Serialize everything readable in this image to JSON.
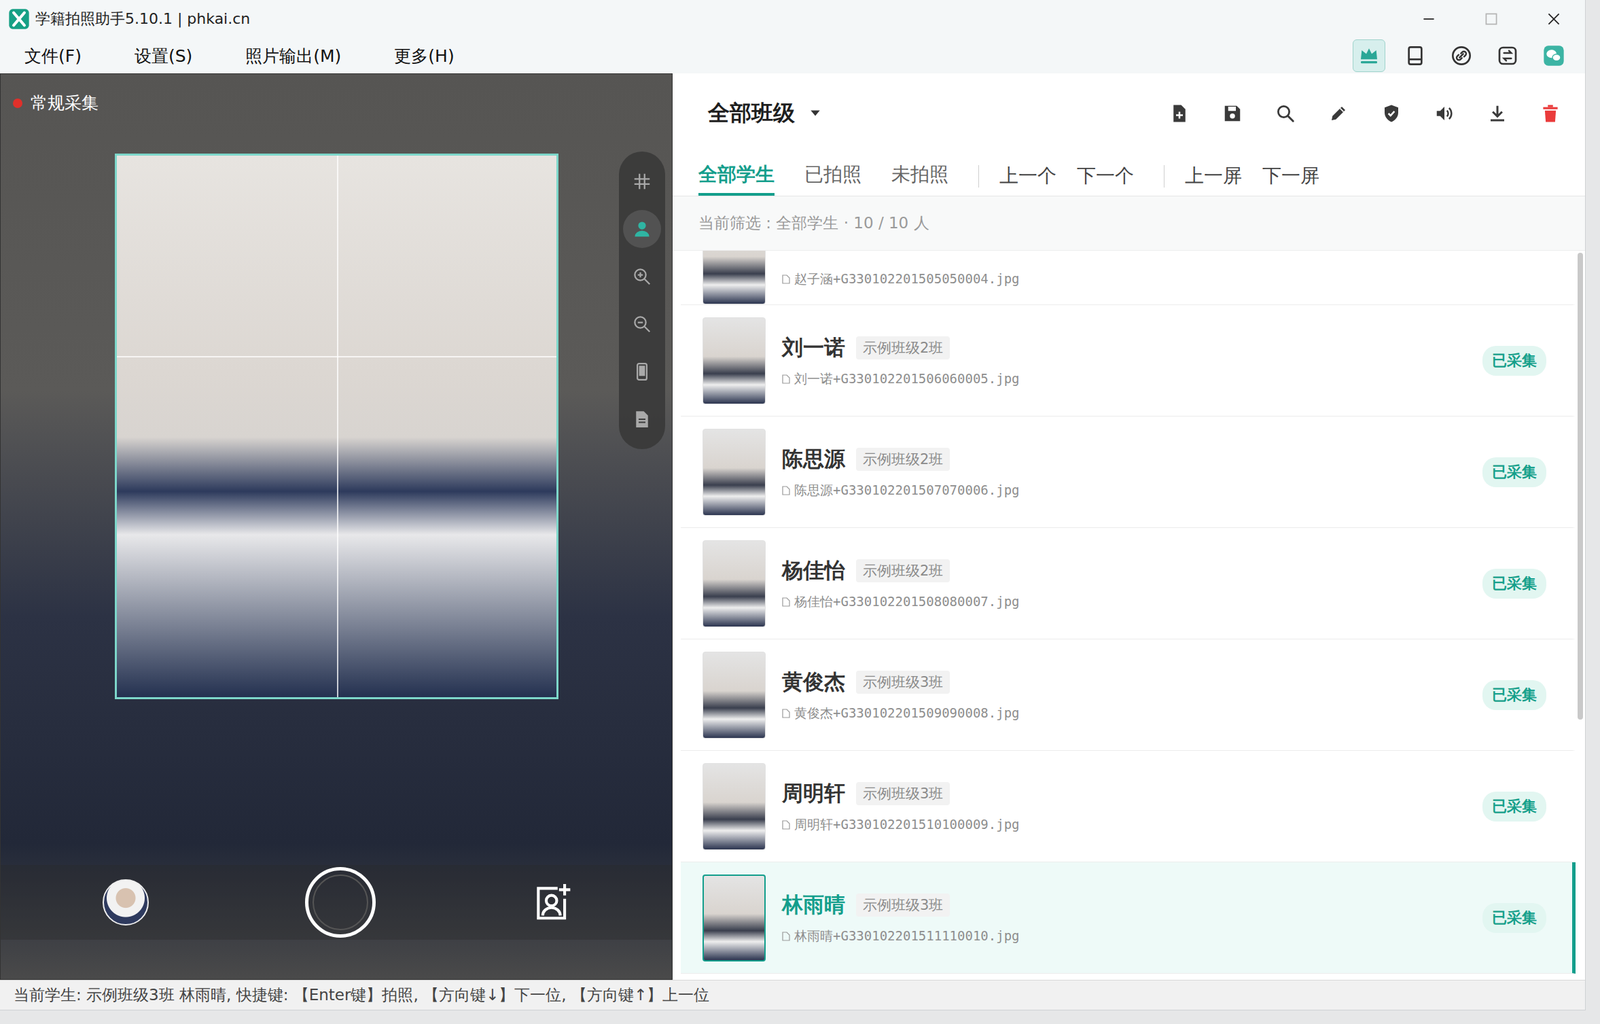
{
  "window": {
    "title": "学籍拍照助手5.10.1 | phkai.cn"
  },
  "window_controls": [
    {
      "kind": "minimize",
      "disabled": false
    },
    {
      "kind": "maximize",
      "disabled": true
    },
    {
      "kind": "close",
      "disabled": false
    }
  ],
  "menu": [
    "文件(F)",
    "设置(S)",
    "照片输出(M)",
    "更多(H)"
  ],
  "menu_icons": [
    {
      "kind": "crown",
      "selected": true
    },
    {
      "kind": "tablet",
      "selected": false
    },
    {
      "kind": "link",
      "selected": false
    },
    {
      "kind": "swap",
      "selected": false
    },
    {
      "kind": "wechat",
      "selected": false
    }
  ],
  "camera": {
    "mode_label": "常规采集",
    "recording": true,
    "tools": [
      {
        "kind": "grid",
        "selected": false
      },
      {
        "kind": "person",
        "selected": true
      },
      {
        "kind": "zoom-in",
        "selected": false
      },
      {
        "kind": "zoom-out",
        "selected": false
      },
      {
        "kind": "phone",
        "selected": false
      },
      {
        "kind": "document",
        "selected": false
      }
    ]
  },
  "class_selector": {
    "label": "全部班级"
  },
  "header_actions": [
    {
      "kind": "file-add"
    },
    {
      "kind": "save"
    },
    {
      "kind": "search"
    },
    {
      "kind": "edit"
    },
    {
      "kind": "shield"
    },
    {
      "kind": "volume"
    },
    {
      "kind": "download"
    },
    {
      "kind": "trash"
    }
  ],
  "tabs": [
    {
      "label": "全部学生",
      "selected": true
    },
    {
      "label": "已拍照",
      "selected": false
    },
    {
      "label": "未拍照",
      "selected": false
    }
  ],
  "nav_groups": [
    [
      "上一个",
      "下一个"
    ],
    [
      "上一屏",
      "下一屏"
    ]
  ],
  "filter": {
    "text": "当前筛选 : 全部学生 · 10 / 10 人"
  },
  "students": [
    {
      "kind": "partial",
      "name": "",
      "class": "",
      "file": "赵子涵+G330102201505050004.jpg",
      "status": "",
      "selected": false
    },
    {
      "kind": "full",
      "name": "刘一诺",
      "class": "示例班级2班",
      "file": "刘一诺+G330102201506060005.jpg",
      "status": "已采集",
      "selected": false
    },
    {
      "kind": "full",
      "name": "陈思源",
      "class": "示例班级2班",
      "file": "陈思源+G330102201507070006.jpg",
      "status": "已采集",
      "selected": false
    },
    {
      "kind": "full",
      "name": "杨佳怡",
      "class": "示例班级2班",
      "file": "杨佳怡+G330102201508080007.jpg",
      "status": "已采集",
      "selected": false
    },
    {
      "kind": "full",
      "name": "黄俊杰",
      "class": "示例班级3班",
      "file": "黄俊杰+G330102201509090008.jpg",
      "status": "已采集",
      "selected": false
    },
    {
      "kind": "full",
      "name": "周明轩",
      "class": "示例班级3班",
      "file": "周明轩+G330102201510100009.jpg",
      "status": "已采集",
      "selected": false
    },
    {
      "kind": "full",
      "name": "林雨晴",
      "class": "示例班级3班",
      "file": "林雨晴+G330102201511110010.jpg",
      "status": "已采集",
      "selected": true
    }
  ],
  "list_scroll": {
    "level": 1
  },
  "status_bar": {
    "text": "当前学生: 示例班级3班 林雨晴, 快捷键: 【Enter键】拍照, 【方向键↓】下一位, 【方向键↑】上一位"
  }
}
